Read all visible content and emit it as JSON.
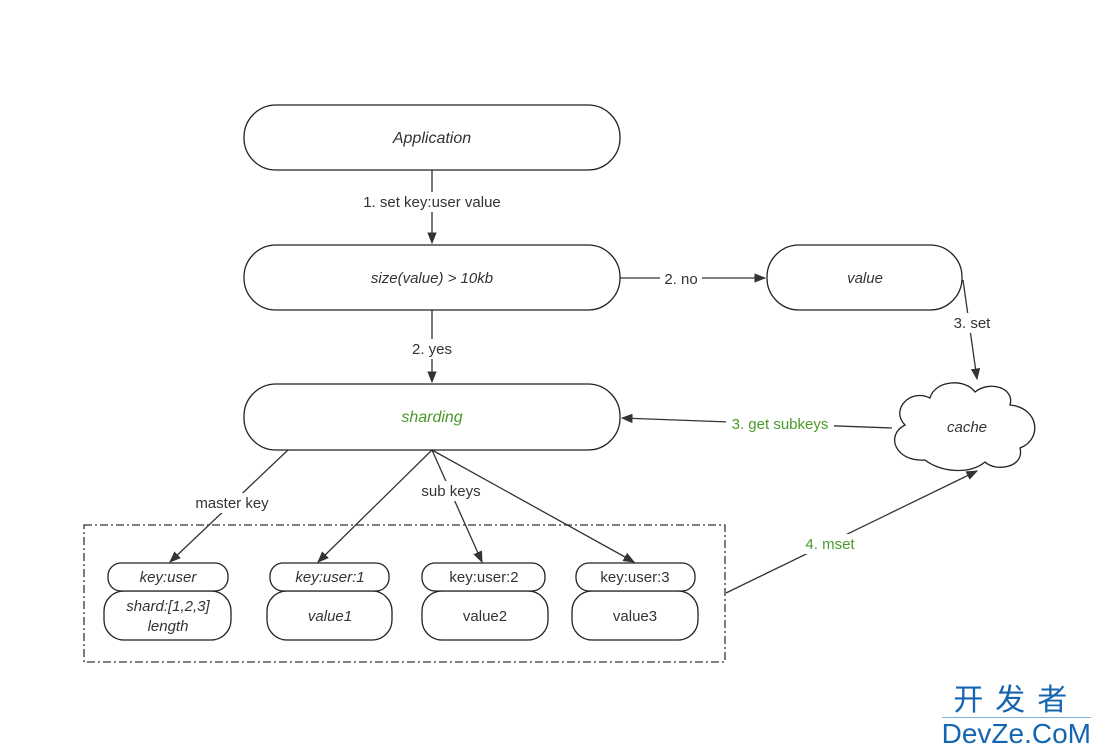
{
  "colors": {
    "green": "#4a9a2a",
    "stroke": "#222222",
    "watermark": "#1565b0"
  },
  "nodes": {
    "application": "Application",
    "size_check": "size(value) > 10kb",
    "value": "value",
    "sharding": "sharding",
    "cache": "cache",
    "master_key": "key:user",
    "master_value_line1": "shard:[1,2,3]",
    "master_value_line2": "length",
    "sub1_key": "key:user:1",
    "sub1_value": "value1",
    "sub2_key": "key:user:2",
    "sub2_value": "value2",
    "sub3_key": "key:user:3",
    "sub3_value": "value3"
  },
  "edges": {
    "set": "1. set key:user value",
    "no": "2. no",
    "yes": "2. yes",
    "set3": "3. set",
    "get_subkeys": "3. get subkeys",
    "master_key": "master key",
    "sub_keys": "sub keys",
    "mset": "4. mset"
  },
  "watermark": {
    "line1": "开发者",
    "line2": "DevZe.CoM"
  }
}
